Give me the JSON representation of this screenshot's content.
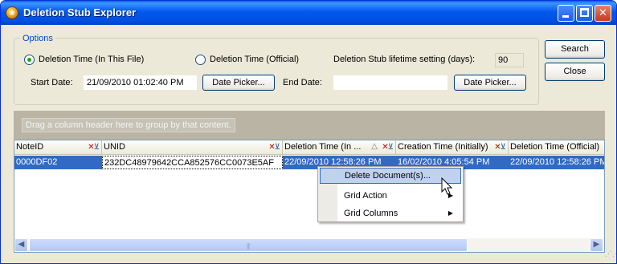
{
  "window": {
    "title": "Deletion Stub Explorer",
    "app_icon_glyph": "❀",
    "minimize_icon": "minimize-icon",
    "maximize_icon": "maximize-icon",
    "close_glyph": "✕"
  },
  "options": {
    "legend": "Options",
    "radio_this_file": "Deletion Time (In This File)",
    "radio_official": "Deletion Time (Official)",
    "selected_radio": "this_file",
    "lifetime_label": "Deletion Stub lifetime setting (days):",
    "lifetime_value": "90",
    "start_date_label": "Start Date:",
    "start_date_value": "21/09/2010 01:02:40 PM",
    "start_picker": "Date Picker...",
    "end_date_label": "End Date:",
    "end_date_value": "",
    "end_picker": "Date Picker..."
  },
  "actions": {
    "search": "Search",
    "close": "Close"
  },
  "grid": {
    "group_hint": "Drag a column header here to group by that content.",
    "columns": [
      "NoteID",
      "UNID",
      "Deletion Time (In ...",
      "Creation Time (Initially)",
      "Deletion Time (Official)"
    ],
    "rows": [
      [
        "0000DF02",
        "232DC48979642CCA852576CC0073E5AF",
        "22/09/2010 12:58:26 PM",
        "16/02/2010 4:05:54 PM",
        "22/09/2010 12:58:26 PM"
      ]
    ],
    "sorted_column": "Deletion Time (In ...",
    "sort_icon": "sort-ascending-icon",
    "filter_icon": "filter-icon"
  },
  "context_menu": {
    "items": [
      {
        "label": "Delete Document(s)...",
        "highlighted": true,
        "submenu": false
      },
      {
        "label": "Grid Action",
        "highlighted": false,
        "submenu": true
      },
      {
        "label": "Grid Columns",
        "highlighted": false,
        "submenu": true
      }
    ]
  },
  "colors": {
    "titlebar": "#0058ee",
    "selection": "#316ac5",
    "menu_highlight": "#c1d2ee",
    "options_legend": "#0046d5"
  }
}
